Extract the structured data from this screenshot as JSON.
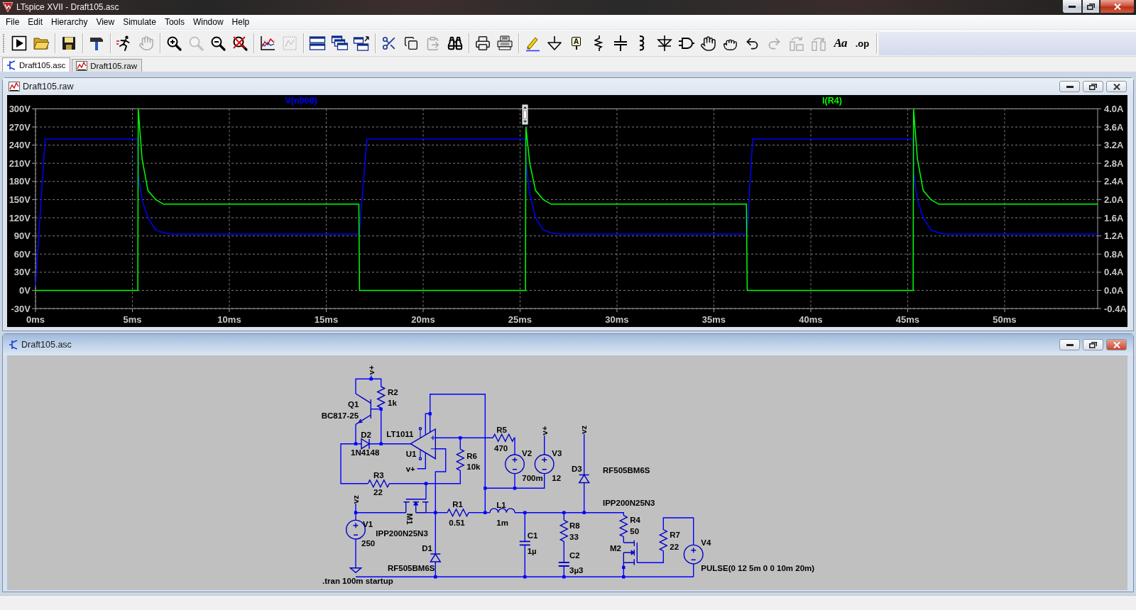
{
  "window": {
    "title": "LTspice XVII - Draft105.asc"
  },
  "menu": [
    "File",
    "Edit",
    "Hierarchy",
    "View",
    "Simulate",
    "Tools",
    "Window",
    "Help"
  ],
  "toolbar": {
    "groups": [
      [
        {
          "disabled": false
        },
        {
          "disabled": false
        }
      ],
      [
        {
          "disabled": false
        }
      ],
      [
        {
          "disabled": false
        }
      ],
      [
        {
          "disabled": false
        },
        {
          "disabled": true
        }
      ],
      [
        {
          "disabled": false
        },
        {
          "disabled": true
        },
        {
          "disabled": false
        },
        {
          "disabled": false
        }
      ],
      [
        {
          "disabled": false
        },
        {
          "disabled": true
        }
      ],
      [
        {
          "disabled": false
        },
        {
          "disabled": false
        },
        {
          "disabled": false
        }
      ],
      [
        {
          "disabled": false
        },
        {
          "disabled": false
        },
        {
          "disabled": true
        },
        {
          "disabled": false
        }
      ],
      [
        {
          "disabled": false
        },
        {
          "disabled": false
        }
      ],
      [
        {
          "disabled": false
        },
        {
          "disabled": false
        },
        {
          "disabled": false,
          "glyph": "A"
        },
        {
          "disabled": false
        },
        {
          "disabled": false
        },
        {
          "disabled": false
        },
        {
          "disabled": false
        },
        {
          "disabled": false
        },
        {
          "disabled": false
        },
        {
          "disabled": false
        },
        {
          "disabled": false
        },
        {
          "disabled": true
        },
        {
          "disabled": true
        },
        {
          "disabled": true
        },
        {
          "disabled": false,
          "glyph": "Aa"
        },
        {
          "disabled": false,
          "glyph": ".op"
        }
      ]
    ]
  },
  "tabs": [
    {
      "label": "Draft105.asc",
      "kind": "schematic",
      "selected": true
    },
    {
      "label": "Draft105.raw",
      "kind": "waveform",
      "selected": false
    }
  ],
  "plot_window": {
    "title": "Draft105.raw",
    "active": false,
    "chart_data": {
      "type": "line",
      "grid": true,
      "x": [
        0,
        0.5,
        5.28,
        5.3,
        5.5,
        5.8,
        6.2,
        6.6,
        7,
        16.68,
        16.72,
        17.1,
        25.28,
        25.3,
        25.5,
        25.8,
        26.2,
        26.6,
        27,
        36.68,
        36.72,
        37,
        45.28,
        45.3,
        45.5,
        45.8,
        46.2,
        46.6,
        47,
        54.8
      ],
      "xlim": [
        0,
        54.8
      ],
      "xticks": [
        {
          "value": 0,
          "label": "0ms"
        },
        {
          "value": 5,
          "label": "5ms"
        },
        {
          "value": 10,
          "label": "10ms"
        },
        {
          "value": 15,
          "label": "15ms"
        },
        {
          "value": 20,
          "label": "20ms"
        },
        {
          "value": 25,
          "label": "25ms"
        },
        {
          "value": 30,
          "label": "30ms"
        },
        {
          "value": 35,
          "label": "35ms"
        },
        {
          "value": 40,
          "label": "40ms"
        },
        {
          "value": 45,
          "label": "45ms"
        },
        {
          "value": 50,
          "label": "50ms"
        }
      ],
      "ylim": [
        -30,
        300
      ],
      "yticks": [
        {
          "value": 300,
          "label": "300V"
        },
        {
          "value": 270,
          "label": "270V"
        },
        {
          "value": 240,
          "label": "240V"
        },
        {
          "value": 210,
          "label": "210V"
        },
        {
          "value": 180,
          "label": "180V"
        },
        {
          "value": 150,
          "label": "150V"
        },
        {
          "value": 120,
          "label": "120V"
        },
        {
          "value": 90,
          "label": "90V"
        },
        {
          "value": 60,
          "label": "60V"
        },
        {
          "value": 30,
          "label": "30V"
        },
        {
          "value": 0,
          "label": "0V"
        },
        {
          "value": -30,
          "label": "-30V"
        }
      ],
      "y2lim": [
        -0.4,
        4
      ],
      "y2ticks": [
        {
          "value": 4,
          "label": "4.0A"
        },
        {
          "value": 3.6,
          "label": "3.6A"
        },
        {
          "value": 3.2,
          "label": "3.2A"
        },
        {
          "value": 2.8,
          "label": "2.8A"
        },
        {
          "value": 2.4,
          "label": "2.4A"
        },
        {
          "value": 2,
          "label": "2.0A"
        },
        {
          "value": 1.6,
          "label": "1.6A"
        },
        {
          "value": 1.2,
          "label": "1.2A"
        },
        {
          "value": 0.8,
          "label": "0.8A"
        },
        {
          "value": 0.4,
          "label": "0.4A"
        },
        {
          "value": 0,
          "label": "0.0A"
        },
        {
          "value": -0.4,
          "label": "-0.4A"
        }
      ],
      "series": [
        {
          "name": "V(n008)",
          "color": "#0000ff",
          "values": [
            8,
            250,
            250,
            190,
            150,
            120,
            100,
            95,
            93,
            93,
            100,
            250,
            250,
            210,
            160,
            120,
            100,
            95,
            93,
            93,
            100,
            250,
            250,
            195,
            150,
            120,
            100,
            95,
            93,
            93
          ]
        },
        {
          "name": "I(R4)",
          "color": "#00ff00",
          "axis": "y2",
          "values": [
            0,
            0,
            0,
            4,
            2.9,
            2.2,
            2,
            1.9,
            1.9,
            1.9,
            0,
            0,
            0,
            3.6,
            2.8,
            2.2,
            2,
            1.9,
            1.9,
            1.9,
            0,
            0,
            0,
            4,
            2.9,
            2.2,
            2,
            1.9,
            1.9,
            1.9
          ]
        }
      ]
    }
  },
  "schematic_window": {
    "title": "Draft105.asc",
    "active": true,
    "components": [
      {
        "kind": "npn",
        "ref": "Q1",
        "value": "BC817-25"
      },
      {
        "kind": "resistor",
        "ref": "R2",
        "value": "1k"
      },
      {
        "kind": "diode",
        "ref": "D2",
        "value": "1N4148"
      },
      {
        "kind": "comparator",
        "ref": "U1",
        "value": "LT1011"
      },
      {
        "kind": "resistor",
        "ref": "R5",
        "value": "470"
      },
      {
        "kind": "resistor",
        "ref": "R6",
        "value": "10k"
      },
      {
        "kind": "vsource",
        "ref": "V2",
        "value": "700m"
      },
      {
        "kind": "vsource",
        "ref": "V3",
        "value": "12"
      },
      {
        "kind": "diode",
        "ref": "D3",
        "value": "RF505BM6S"
      },
      {
        "kind": "resistor",
        "ref": "R3",
        "value": "22"
      },
      {
        "kind": "vsource",
        "ref": "V1",
        "value": "250"
      },
      {
        "kind": "nmos",
        "ref": "M1",
        "value": "IPP200N25N3"
      },
      {
        "kind": "resistor",
        "ref": "R1",
        "value": "0.51"
      },
      {
        "kind": "inductor",
        "ref": "L1",
        "value": "1m"
      },
      {
        "kind": "diode",
        "ref": "D1",
        "value": "RF505BM6S"
      },
      {
        "kind": "capacitor",
        "ref": "C1",
        "value": "1µ"
      },
      {
        "kind": "resistor",
        "ref": "R8",
        "value": "33"
      },
      {
        "kind": "capacitor",
        "ref": "C2",
        "value": "3µ3"
      },
      {
        "kind": "nmos",
        "ref": "M2",
        "value": "IPP200N25N3"
      },
      {
        "kind": "resistor",
        "ref": "R4",
        "value": "50"
      },
      {
        "kind": "resistor",
        "ref": "R7",
        "value": "22"
      },
      {
        "kind": "vsource",
        "ref": "V4",
        "value": "PULSE(0 12 5m 0 0 10m 20m)"
      }
    ],
    "net_labels": [
      "v+",
      "vz",
      "v+",
      "v+",
      "vz"
    ],
    "directive": ".tran 100m startup"
  }
}
